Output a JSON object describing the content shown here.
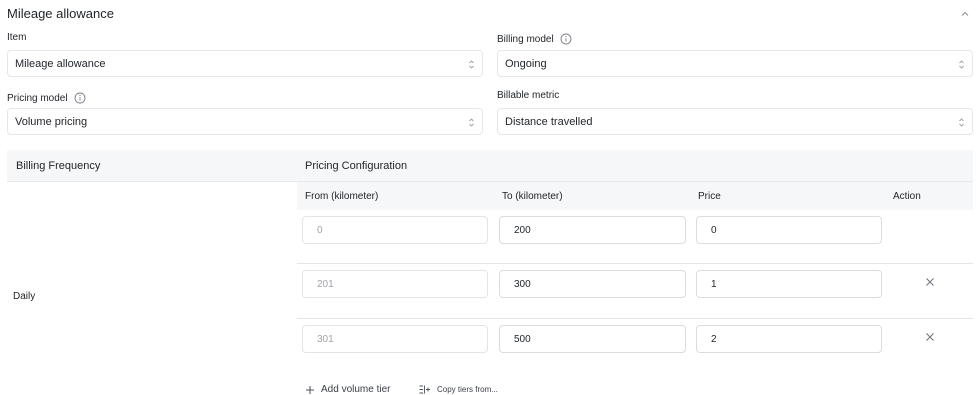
{
  "section": {
    "title": "Mileage allowance"
  },
  "fields": {
    "item": {
      "label": "Item",
      "value": "Mileage allowance"
    },
    "billing_model": {
      "label": "Billing model",
      "value": "Ongoing"
    },
    "pricing_model": {
      "label": "Pricing model",
      "value": "Volume pricing"
    },
    "billable_metric": {
      "label": "Billable metric",
      "value": "Distance travelled"
    }
  },
  "table": {
    "headers": {
      "billing_frequency": "Billing Frequency",
      "pricing_configuration": "Pricing Configuration"
    },
    "subheaders": {
      "from": "From (kilometer)",
      "to": "To (kilometer)",
      "price": "Price",
      "action": "Action"
    },
    "frequency": "Daily",
    "tiers": [
      {
        "from": "0",
        "to": "200",
        "price": "0",
        "removable": false
      },
      {
        "from": "201",
        "to": "300",
        "price": "1",
        "removable": true
      },
      {
        "from": "301",
        "to": "500",
        "price": "2",
        "removable": true
      }
    ]
  },
  "footer": {
    "add_tier": "Add volume tier",
    "copy_tiers": "Copy tiers from..."
  },
  "icons": {
    "collapse": "chevron-up-icon",
    "info": "info-icon",
    "select": "select-caret-icon",
    "remove": "close-icon",
    "add": "plus-icon",
    "copy": "copy-tiers-icon"
  }
}
